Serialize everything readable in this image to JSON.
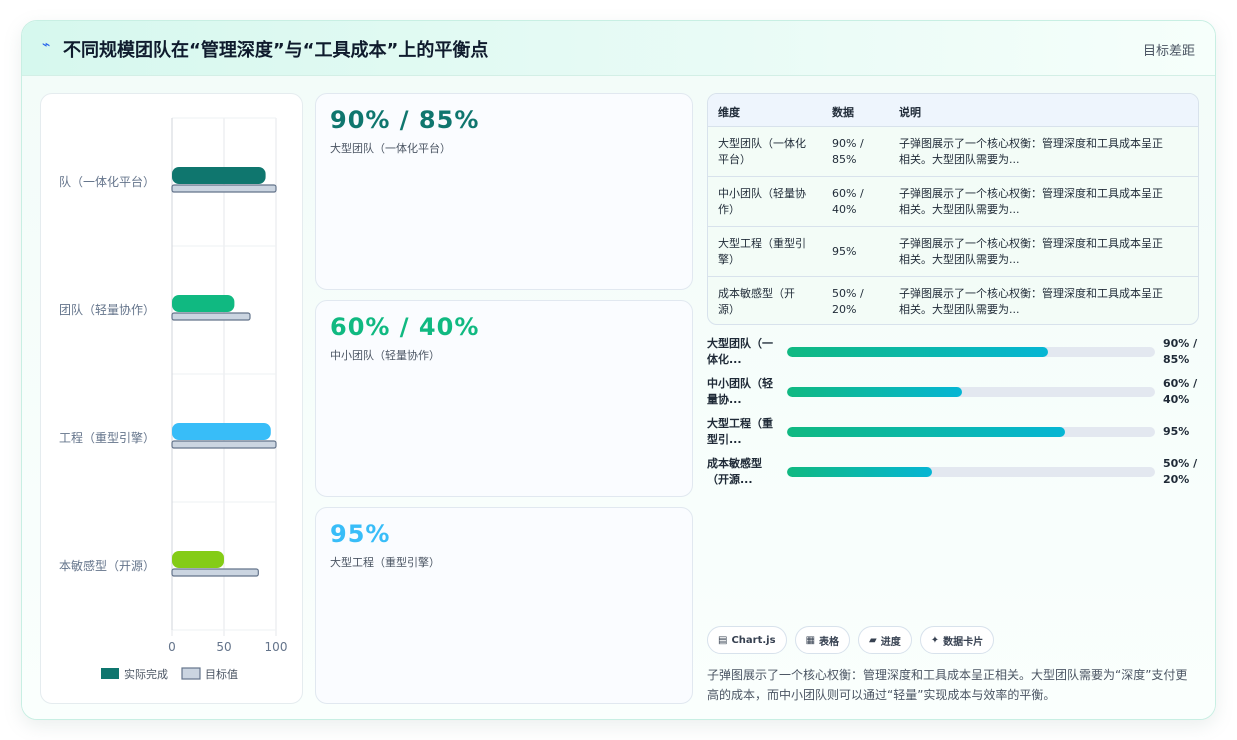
{
  "header": {
    "icon": "lightning-icon",
    "title": "不同规模团队在“管理深度”与“工具成本”上的平衡点",
    "tag": "目标差距"
  },
  "chart_data": {
    "type": "bar",
    "orientation": "horizontal",
    "categories": [
      "大型团队（一体化平台）",
      "中小团队（轻量协作）",
      "大型工程（重型引擎）",
      "成本敏感型（开源）"
    ],
    "visible_tick_labels": [
      "队（一体化平台）",
      "团队（轻量协作）",
      "工程（重型引擎）",
      "本敏感型（开源）"
    ],
    "series": [
      {
        "name": "实际完成",
        "values": [
          90,
          60,
          95,
          50
        ],
        "colors": [
          "#0f766e",
          "#10b981",
          "#38bdf8",
          "#84cc16"
        ]
      },
      {
        "name": "目标值",
        "values": [
          100,
          75,
          100,
          83
        ],
        "color": "#cbd5e1"
      }
    ],
    "xlim": [
      0,
      100
    ],
    "xticks": [
      "0",
      "50",
      "100"
    ],
    "grid": true,
    "legend_position": "bottom"
  },
  "stats": [
    {
      "value": "90% / 85%",
      "label": "大型团队（一体化平台）",
      "color": "#0f766e"
    },
    {
      "value": "60% / 40%",
      "label": "中小团队（轻量协作）",
      "color": "#10b981"
    },
    {
      "value": "95%",
      "label": "大型工程（重型引擎）",
      "color": "#38bdf8"
    }
  ],
  "table": {
    "headers": [
      "维度",
      "数据",
      "说明"
    ],
    "rows": [
      {
        "dim": [
          "大型团队（一体化",
          "平台）"
        ],
        "data": [
          "90% /",
          "85%"
        ],
        "desc": [
          "子弹图展示了一个核心权衡：管理深度和工具成本呈正",
          "相关。大型团队需要为..."
        ]
      },
      {
        "dim": [
          "中小团队（轻量协",
          "作）"
        ],
        "data": [
          "60% /",
          "40%"
        ],
        "desc": [
          "子弹图展示了一个核心权衡：管理深度和工具成本呈正",
          "相关。大型团队需要为..."
        ]
      },
      {
        "dim": [
          "大型工程（重型引",
          "擎）"
        ],
        "data": [
          "95%",
          ""
        ],
        "desc": [
          "子弹图展示了一个核心权衡：管理深度和工具成本呈正",
          "相关。大型团队需要为..."
        ]
      },
      {
        "dim": [
          "成本敏感型（开",
          "源）"
        ],
        "data": [
          "50% /",
          "20%"
        ],
        "desc": [
          "子弹图展示了一个核心权衡：管理深度和工具成本呈正",
          "相关。大型团队需要为..."
        ]
      }
    ]
  },
  "progress": [
    {
      "label": [
        "大型团队（一",
        "体化..."
      ],
      "value": [
        "90% /",
        "85%"
      ],
      "fraction": 0.71
    },
    {
      "label": [
        "中小团队（轻",
        "量协..."
      ],
      "value": [
        "60% /",
        "40%"
      ],
      "fraction": 0.475
    },
    {
      "label": [
        "大型工程（重",
        "型引..."
      ],
      "value": [
        "95%",
        ""
      ],
      "fraction": 0.755
    },
    {
      "label": [
        "成本敏感型",
        "（开源..."
      ],
      "value": [
        "50% /",
        "20%"
      ],
      "fraction": 0.395
    }
  ],
  "chips": [
    {
      "icon": "chart-icon",
      "glyph": "▤",
      "label": "Chart.js"
    },
    {
      "icon": "table-icon",
      "glyph": "▦",
      "label": "表格"
    },
    {
      "icon": "progress-icon",
      "glyph": "▰",
      "label": "进度"
    },
    {
      "icon": "sparkle-icon",
      "glyph": "✦",
      "label": "数据卡片"
    }
  ],
  "note": "子弹图展示了一个核心权衡：管理深度和工具成本呈正相关。大型团队需要为“深度”支付更高的成本，而中小团队则可以通过“轻量”实现成本与效率的平衡。"
}
